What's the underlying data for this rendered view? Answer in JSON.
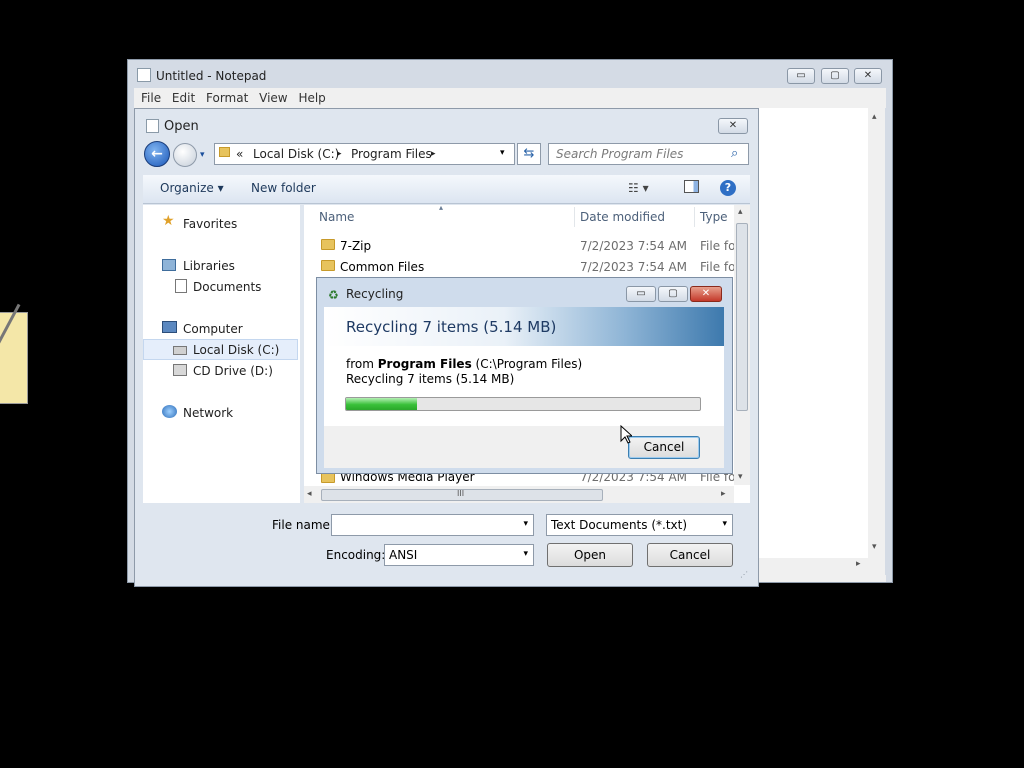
{
  "notepad": {
    "title": "Untitled - Notepad",
    "menu": [
      "File",
      "Edit",
      "Format",
      "View",
      "Help"
    ]
  },
  "open_dialog": {
    "title": "Open",
    "address": {
      "overflow": "«",
      "crumbs": [
        "Local Disk (C:)",
        "Program Files"
      ],
      "sep": "▸"
    },
    "search_placeholder": "Search Program Files",
    "toolbar": {
      "organize": "Organize ▾",
      "new_folder": "New folder"
    },
    "nav": {
      "favorites": "Favorites",
      "libraries": "Libraries",
      "documents": "Documents",
      "computer": "Computer",
      "local_disk": "Local Disk (C:)",
      "cd_drive": "CD Drive (D:)",
      "network": "Network"
    },
    "columns": {
      "name": "Name",
      "date": "Date modified",
      "type": "Type"
    },
    "files": [
      {
        "name": "7-Zip",
        "date": "7/2/2023 7:54 AM",
        "type": "File fol"
      },
      {
        "name": "Common Files",
        "date": "7/2/2023 7:54 AM",
        "type": "File fol"
      },
      {
        "name": "Windows Media Player",
        "date": "7/2/2023 7:54 AM",
        "type": "File fol"
      }
    ],
    "file_name_label": "File name:",
    "file_name_value": "",
    "file_type": "Text Documents (*.txt)",
    "encoding_label": "Encoding:",
    "encoding_value": "ANSI",
    "open_button": "Open",
    "cancel_button": "Cancel",
    "scroll_grip": "III"
  },
  "recycling": {
    "title": "Recycling",
    "heading": "Recycling 7 items (5.14 MB)",
    "from_prefix": "from",
    "from_bold": "Program Files",
    "from_path": "(C:\\Program Files)",
    "status": "Recycling 7 items (5.14 MB)",
    "progress": 0.2,
    "cancel_button": "Cancel"
  },
  "icons": {
    "minimize": "▭",
    "maximize": "▢",
    "close": "✕",
    "back": "←",
    "refresh": "⇆",
    "search": "⌕",
    "dropdown": "▾",
    "scroll_up": "▴",
    "scroll_down": "▾",
    "scroll_left": "◂",
    "scroll_right": "▸"
  }
}
